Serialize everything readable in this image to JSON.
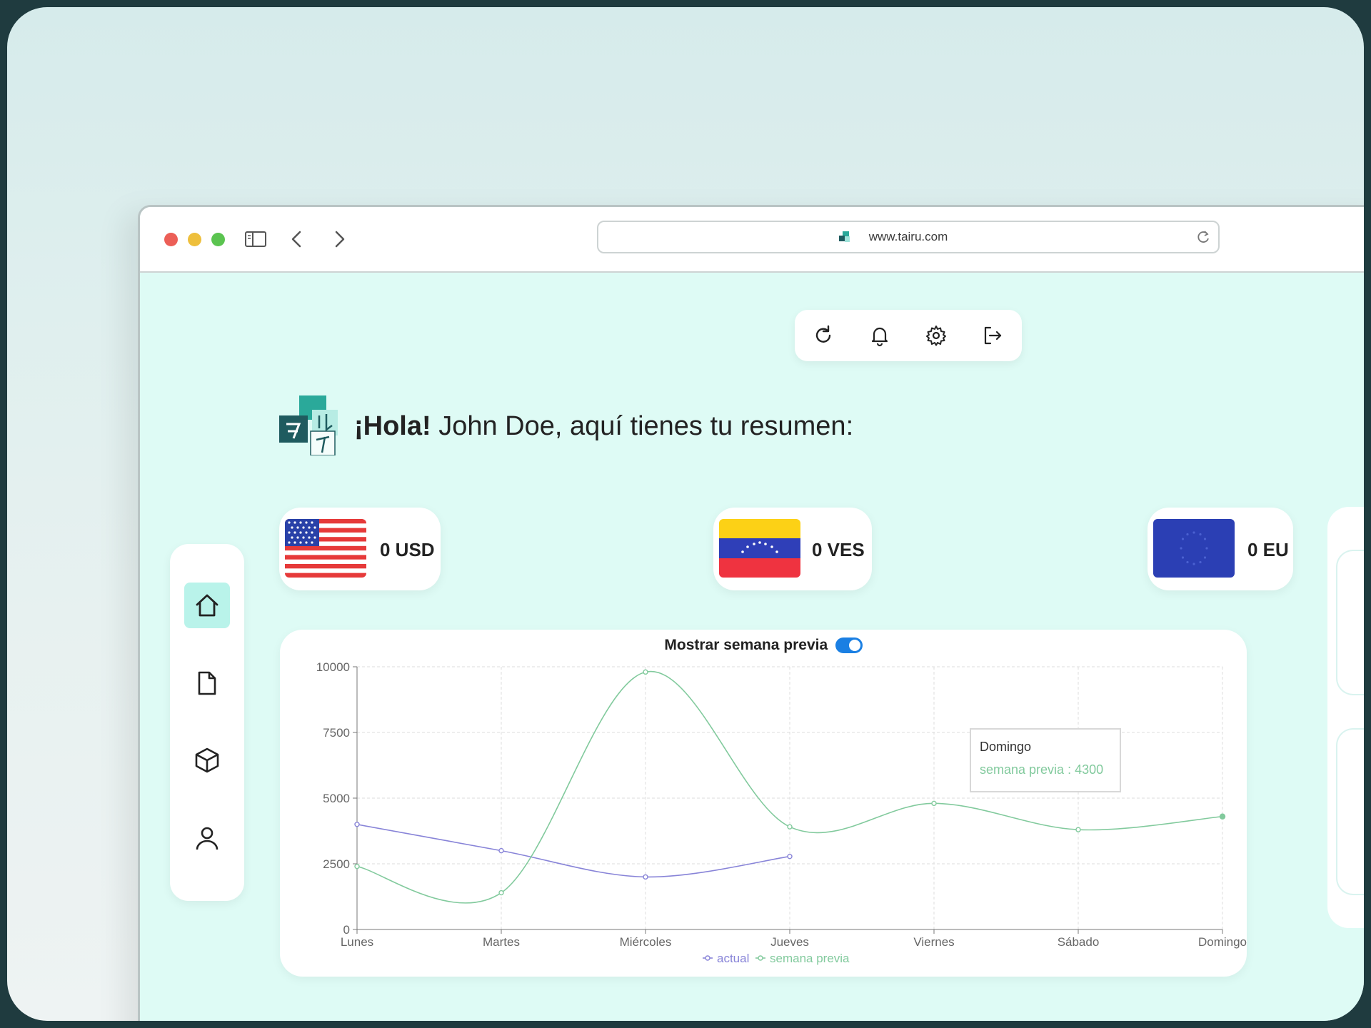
{
  "browser": {
    "url": "www.tairu.com"
  },
  "greeting": {
    "bold": "¡Hola!",
    "rest": " John Doe, aquí tienes tu resumen:"
  },
  "currencies": [
    {
      "label": "0 USD",
      "flag": "us-flag-icon"
    },
    {
      "label": "0 VES",
      "flag": "venezuela-flag-icon"
    },
    {
      "label": "0 EU",
      "flag": "eu-flag-icon"
    }
  ],
  "toolbar": {
    "icons": [
      "refresh-icon",
      "bell-icon",
      "gear-icon",
      "logout-icon"
    ]
  },
  "sidebar": {
    "items": [
      "home-icon",
      "document-icon",
      "box-icon",
      "user-icon"
    ],
    "active": "home-icon"
  },
  "chart_header": {
    "title": "Mostrar semana previa",
    "toggle_on": true
  },
  "tooltip": {
    "title": "Domingo",
    "value": "semana previa : 4300"
  },
  "colors": {
    "actual": "#8884d8",
    "previous": "#82ca9d",
    "accent": "#1a7fe3"
  },
  "chart_data": {
    "type": "line",
    "categories": [
      "Lunes",
      "Martes",
      "Miércoles",
      "Jueves",
      "Viernes",
      "Sábado",
      "Domingo"
    ],
    "ylim": [
      0,
      10000
    ],
    "yticks": [
      "0",
      "2500",
      "5000",
      "7500",
      "10000"
    ],
    "series": [
      {
        "name": "actual",
        "values": [
          4000,
          3000,
          2000,
          2780,
          null,
          null,
          null
        ]
      },
      {
        "name": "semana previa",
        "values": [
          2400,
          1398,
          9800,
          3908,
          4800,
          3800,
          4300
        ]
      }
    ],
    "legend": "bottom",
    "grid": true
  }
}
